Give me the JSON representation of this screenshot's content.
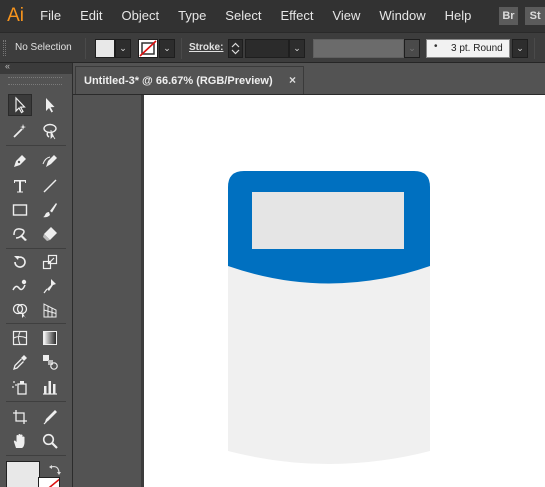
{
  "app": {
    "logo": "Ai"
  },
  "menu": [
    "File",
    "Edit",
    "Object",
    "Type",
    "Select",
    "Effect",
    "View",
    "Window",
    "Help"
  ],
  "bridge_buttons": [
    "Br",
    "St"
  ],
  "control_bar": {
    "selection_label": "No Selection",
    "stroke_label": "Stroke:",
    "brush_value": "3 pt. Round",
    "brush_dot": "•",
    "dropdown_glyph": "⌄"
  },
  "tools_panel": {
    "collapse_glyph": "«"
  },
  "document": {
    "tab_title": "Untitled-3* @ 66.67% (RGB/Preview)",
    "close_glyph": "×"
  },
  "colors": {
    "accent_blue": "#0070c0",
    "label_gray": "#e5e5e5",
    "body_gray": "#f0f0f0",
    "fill_swatch": "#e8e8e8",
    "stroke_none": "#d11"
  },
  "icons": [
    "selection-tool-icon",
    "direct-selection-tool-icon",
    "magic-wand-icon",
    "lasso-icon",
    "pen-tool-icon",
    "curvature-tool-icon",
    "type-tool-icon",
    "line-tool-icon",
    "rectangle-tool-icon",
    "paintbrush-icon",
    "shaper-tool-icon",
    "eraser-icon",
    "rotate-tool-icon",
    "scale-tool-icon",
    "warp-tool-icon",
    "puppet-warp-icon",
    "shape-builder-icon",
    "perspective-grid-icon",
    "mesh-tool-icon",
    "gradient-tool-icon",
    "eyedropper-icon",
    "blend-tool-icon",
    "symbol-sprayer-icon",
    "column-graph-icon",
    "artboard-tool-icon",
    "slice-tool-icon",
    "hand-tool-icon",
    "zoom-tool-icon",
    "swap-fill-stroke-icon"
  ]
}
